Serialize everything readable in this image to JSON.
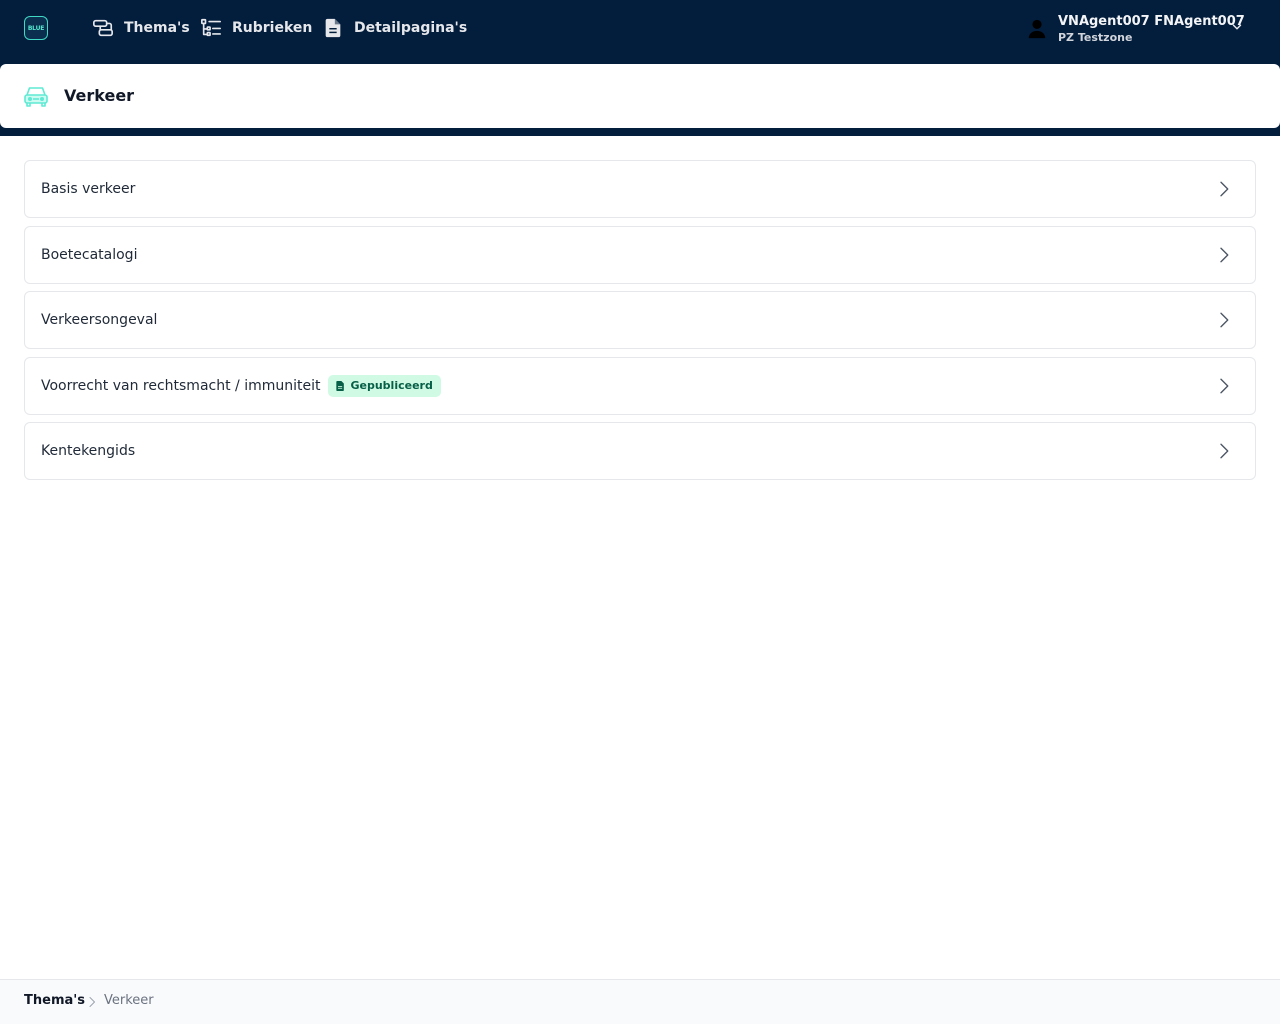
{
  "brand": {
    "logo_text": "BLUE",
    "accent": "#3fd9c4"
  },
  "nav": {
    "items": [
      {
        "label": "Thema's",
        "icon": "themes-icon"
      },
      {
        "label": "Rubrieken",
        "icon": "list-tree-icon"
      },
      {
        "label": "Detailpagina's",
        "icon": "document-icon"
      }
    ]
  },
  "user": {
    "name": "VNAgent007 FNAgent007",
    "zone": "PZ Testzone",
    "icon": "user-icon"
  },
  "page": {
    "title": "Verkeer",
    "icon": "car-icon"
  },
  "list": {
    "items": [
      {
        "label": "Basis verkeer"
      },
      {
        "label": "Boetecatalogi"
      },
      {
        "label": "Verkeersongeval"
      },
      {
        "label": "Voorrecht van rechtsmacht / immuniteit",
        "badge": "Gepubliceerd"
      },
      {
        "label": "Kentekengids"
      }
    ]
  },
  "breadcrumb": {
    "items": [
      "Thema's",
      "Verkeer"
    ]
  },
  "colors": {
    "topbar": "#031d3d",
    "badge_bg": "#d1fae5",
    "badge_text": "#065f46"
  }
}
